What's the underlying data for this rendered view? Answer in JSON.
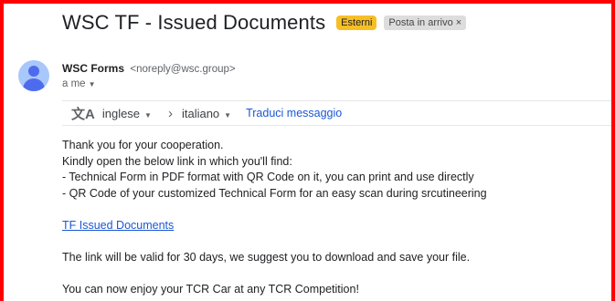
{
  "email": {
    "subject": "WSC TF - Issued Documents",
    "labels": {
      "external": "Esterni",
      "inbox": "Posta in arrivo",
      "inbox_remove": "×"
    },
    "sender": {
      "name": "WSC Forms",
      "email": "<noreply@wsc.group>",
      "to": "a me"
    },
    "translate": {
      "from_lang": "inglese",
      "to_lang": "italiano",
      "action": "Traduci messaggio"
    },
    "body": {
      "line1": "Thank you for your cooperation.",
      "line2": "Kindly open the below link in which you'll find:",
      "line3": "- Technical Form in PDF format with QR Code on it, you can print and use directly",
      "line4": "- QR Code of your customized Technical Form for an easy scan during srcutineering",
      "link_text": "TF Issued Documents",
      "line5": "The link will be valid for 30 days, we suggest you to download and save your file.",
      "line6": "You can now enjoy your TCR Car at any TCR Competition!"
    }
  },
  "colors": {
    "frame": "#ff0000",
    "badge_external": "#f6bf26",
    "link": "#1a57d6",
    "avatar_bg": "#a8c7fa",
    "avatar_fg": "#4f6bed"
  }
}
